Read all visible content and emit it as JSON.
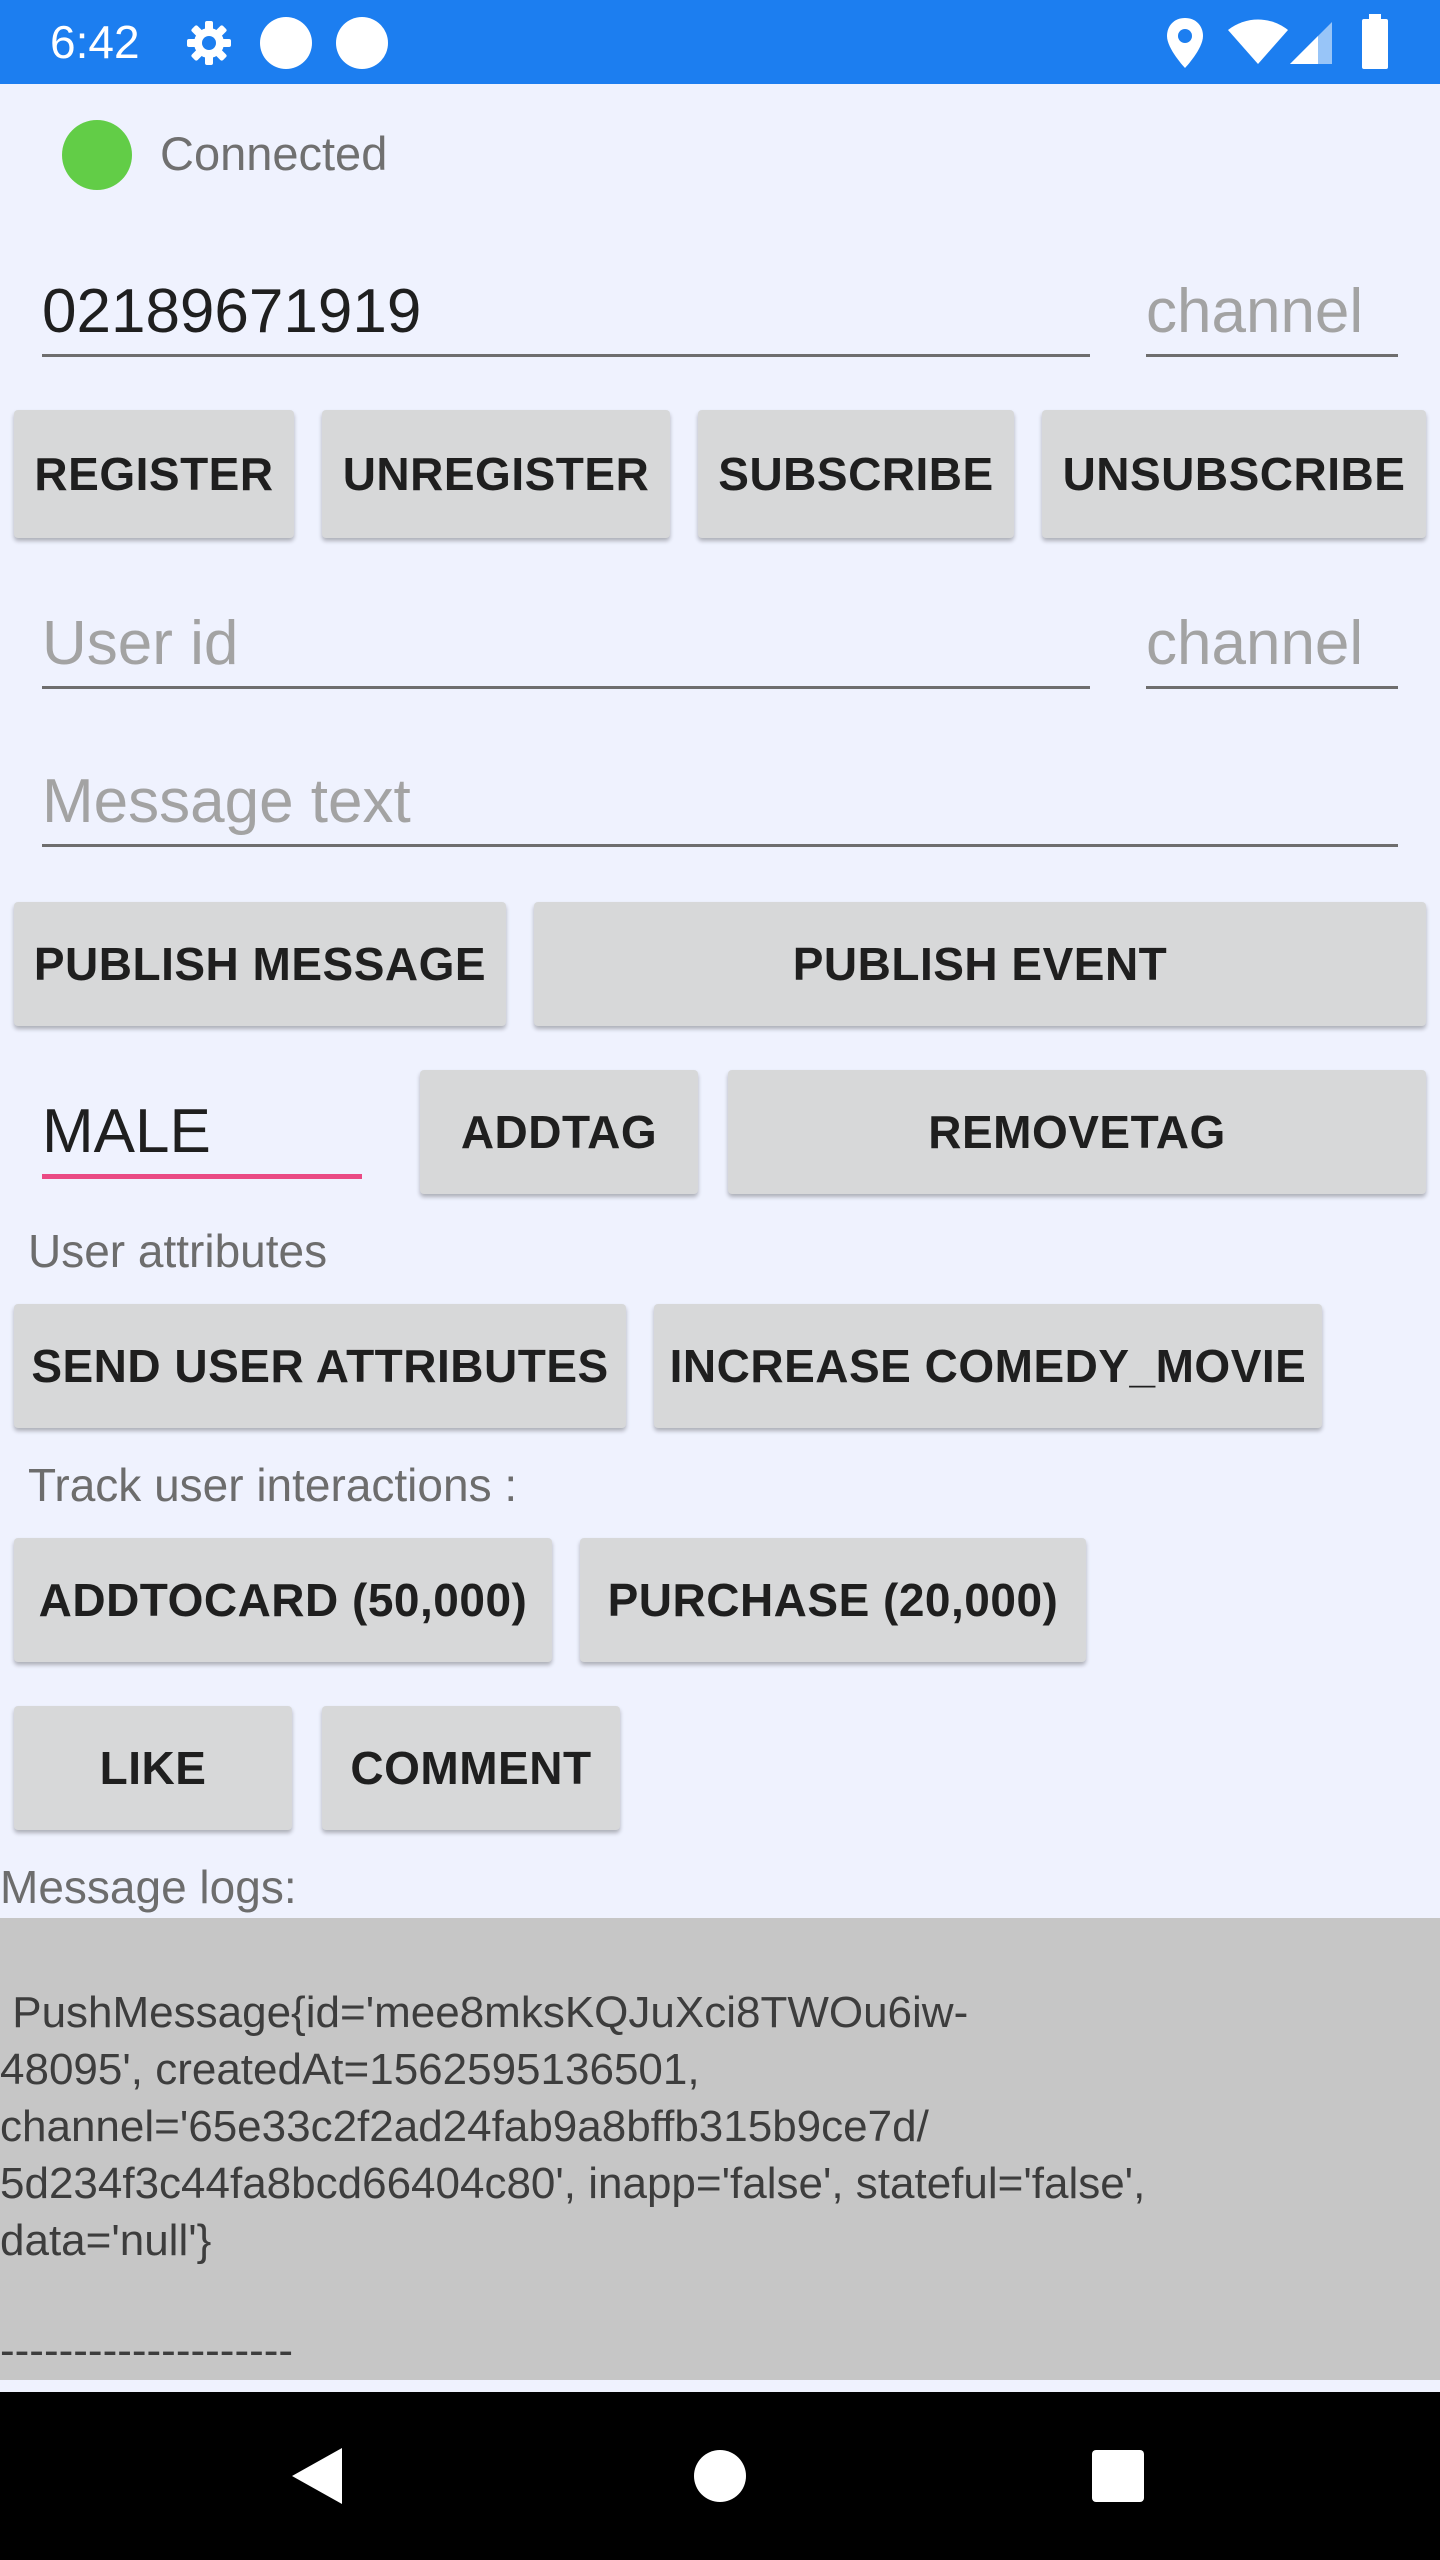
{
  "status_bar": {
    "time": "6:42",
    "icons_left": [
      "gear-icon",
      "circle-icon",
      "circle-icon"
    ],
    "icons_right": [
      "location-icon",
      "wifi-icon",
      "cell-signal-icon",
      "battery-icon"
    ],
    "background": "#1c7ef0"
  },
  "connection": {
    "status": "Connected",
    "indicator_color": "#62cd47"
  },
  "register_row": {
    "id_value": "02189671919",
    "channel_placeholder": "channel"
  },
  "channel_buttons": {
    "register": "REGISTER",
    "unregister": "UNREGISTER",
    "subscribe": "SUBSCRIBE",
    "unsubscribe": "UNSUBSCRIBE"
  },
  "message_row": {
    "user_id_placeholder": "User id",
    "channel_placeholder": "channel",
    "message_placeholder": "Message text"
  },
  "publish_buttons": {
    "publish_message": "PUBLISH MESSAGE",
    "publish_event": "PUBLISH EVENT"
  },
  "tag_row": {
    "tag_value": "MALE",
    "add_tag": "ADDTAG",
    "remove_tag": "REMOVETAG",
    "focus_color": "#ea4a84"
  },
  "user_attributes": {
    "label": "User attributes",
    "send": "SEND USER ATTRIBUTES",
    "increase": "INCREASE COMEDY_MOVIE"
  },
  "interactions": {
    "label": "Track user interactions :",
    "add_to_card": "ADDTOCARD (50,000)",
    "purchase": "PURCHASE (20,000)",
    "like": "LIKE",
    "comment": "COMMENT"
  },
  "logs": {
    "label": "Message logs:",
    "text": " PushMessage{id='mee8mksKQJuXci8TWOu6iw-\n48095', createdAt=1562595136501,\nchannel='65e33c2f2ad24fab9a8bffb315b9ce7d/\n5d234f3c44fa8bcd66404c80', inapp='false', stateful='false',\ndata='null'}",
    "separator": "--------------------"
  },
  "nav_bar": {
    "icons": [
      "back-icon",
      "home-icon",
      "recents-icon"
    ]
  }
}
